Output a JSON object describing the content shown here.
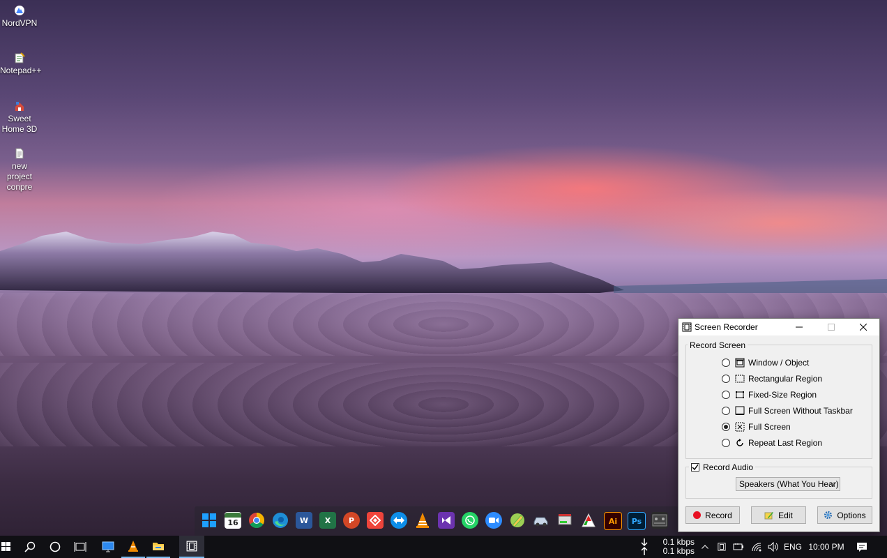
{
  "desktop": {
    "icons": [
      {
        "label": "NordVPN",
        "icon": "nordvpn-icon"
      },
      {
        "label": "Notepad++",
        "icon": "notepad-plus-plus-icon"
      },
      {
        "label": "Sweet Home 3D",
        "icon": "sweet-home-3d-icon"
      },
      {
        "label": "new project conpre",
        "icon": "document-icon"
      }
    ]
  },
  "dock": {
    "icons": [
      "windows-icon",
      "calendar-icon",
      "chrome-icon",
      "edge-icon",
      "word-icon",
      "excel-icon",
      "powerpoint-icon",
      "anydesk-icon",
      "teamviewer-icon",
      "vlc-icon",
      "visual-studio-icon",
      "whatsapp-icon",
      "zoom-icon",
      "pencil-icon",
      "car-icon",
      "hard-drive-icon",
      "flag-icon",
      "illustrator-icon",
      "photoshop-icon",
      "settings-panel-icon"
    ],
    "calendar_day": "16",
    "word_letter": "W",
    "excel_letter": "X",
    "powerpoint_letter": "P",
    "illustrator_letter": "Ai",
    "photoshop_letter": "Ps"
  },
  "window": {
    "title": "Screen Recorder",
    "record_screen": {
      "legend": "Record Screen",
      "options": [
        {
          "label": "Window / Object",
          "selected": false,
          "icon": "window-object-icon"
        },
        {
          "label": "Rectangular Region",
          "selected": false,
          "icon": "rectangular-region-icon"
        },
        {
          "label": "Fixed-Size Region",
          "selected": false,
          "icon": "fixed-size-region-icon"
        },
        {
          "label": "Full Screen Without Taskbar",
          "selected": false,
          "icon": "full-screen-without-taskbar-icon"
        },
        {
          "label": "Full Screen",
          "selected": true,
          "icon": "full-screen-icon"
        },
        {
          "label": "Repeat Last Region",
          "selected": false,
          "icon": "repeat-last-region-icon"
        }
      ]
    },
    "record_audio": {
      "legend": "Record Audio",
      "checked": true,
      "source": "Speakers (What You Hear)"
    },
    "buttons": {
      "record": "Record",
      "edit": "Edit",
      "options": "Options"
    }
  },
  "taskbar": {
    "net_down": "0.1 kbps",
    "net_up": "0.1 kbps",
    "language": "ENG",
    "time": "10:00 PM"
  },
  "colors": {
    "record_dot": "#e81123",
    "taskbar_bg": "#101014",
    "active_app": "#2e2e38"
  }
}
